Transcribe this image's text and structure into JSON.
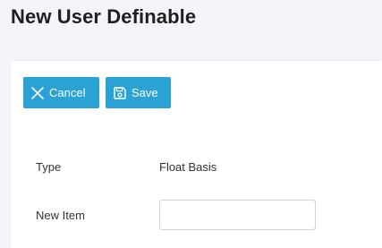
{
  "page": {
    "title": "New User Definable"
  },
  "toolbar": {
    "cancel_label": "Cancel",
    "cancel_icon": "close-icon",
    "save_label": "Save",
    "save_icon": "floppy-disk-icon",
    "button_color": "#2aa3d4"
  },
  "form": {
    "type_label": "Type",
    "type_value": "Float Basis",
    "new_item_label": "New Item",
    "new_item_value": "",
    "new_item_placeholder": ""
  }
}
